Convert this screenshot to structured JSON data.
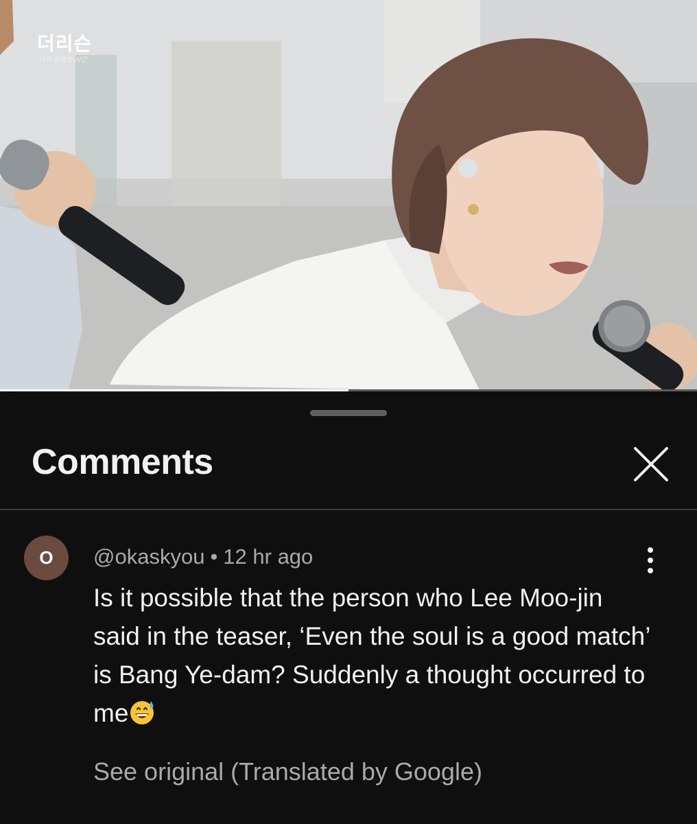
{
  "video": {
    "channel_logo_text": "더리슨",
    "channel_logo_subtitle": "너와 함께한 시간",
    "progress_fraction": 0.5
  },
  "comments_panel": {
    "title": "Comments",
    "close_icon": "close-icon"
  },
  "comment": {
    "avatar_initial": "O",
    "avatar_color": "#6b4b3e",
    "author": "@okaskyou",
    "separator": "•",
    "time": "12 hr ago",
    "text": "Is it possible that the person who Lee Moo-jin said in the teaser, ‘Even the soul is a good match’ is Bang Ye-dam? Suddenly a thought occurred to me",
    "emoji": "grinning-face-with-sweat-emoji",
    "more_icon": "more-vert-icon",
    "see_original_label": "See original (Translated by Google)"
  }
}
